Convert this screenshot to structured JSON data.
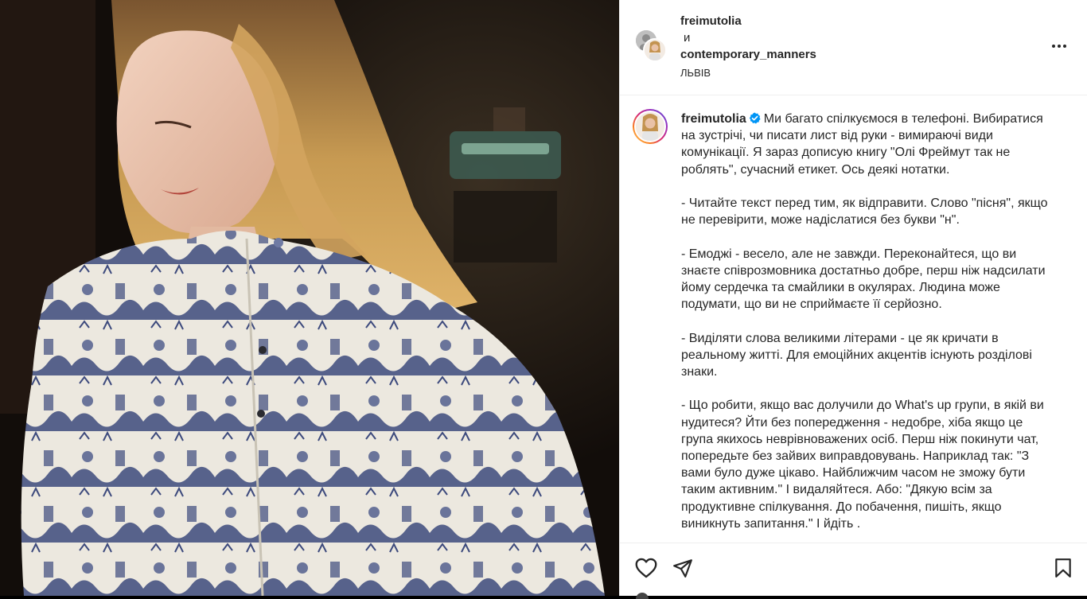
{
  "header": {
    "username_primary": "freimutolia",
    "connector": "и",
    "username_collab": "contemporary_manners",
    "location": "ЛЬВІВ",
    "more_icon": "more-horizontal-icon"
  },
  "caption": {
    "username": "freimutolia",
    "verified_icon": "verified-badge-icon",
    "text": "Ми багато спілкуємося в телефоні. Вибиратися на зустрічі, чи писати лист від руки - вимираючі види комунікації. Я зараз дописую книгу \"Олі Фреймут так не роблять\", сучасний етикет. Ось деякі нотатки.\n\n- Читайте текст перед тим, як відправити. Слово \"пісня\", якщо не перевірити, може надіслатися без букви \"н\".\n\n- Емоджі - весело, але не завжди. Переконайтеся, що ви знаєте співрозмовника достатньо добре, перш ніж надсилати йому сердечка та смайлики в окулярах. Людина може подумати, що ви не сприймаєте її серйозно.\n\n- Виділяти слова великими літерами - це як кричати в реальному житті. Для емоційних акцентів існують розділові знаки.\n\n- Що робити, якщо вас долучили до What's up групи, в якій ви нудитеся? Йти без попередження - недобре, хіба якщо це група якихось неврівноважених осіб. Перш ніж покинути чат, попередьте без зайвих виправдовувань. Наприклад так: \"З вами було дуже цікаво. Найближчим часом не зможу бути таким активним.\" І видаляйтеся. Або: \"Дякую всім за продуктивне спілкування. До побачення, пишіть, якщо виникнуть запитання.\" І йдіть ."
  },
  "actions": {
    "like_icon": "heart-icon",
    "share_icon": "paper-plane-icon",
    "save_icon": "bookmark-icon"
  },
  "colors": {
    "text": "#262626",
    "divider": "#efefef",
    "verified": "#0095f6",
    "shirt_print": "#3d4a7d",
    "shirt_base": "#ece8df",
    "hair": "#c08a45"
  }
}
